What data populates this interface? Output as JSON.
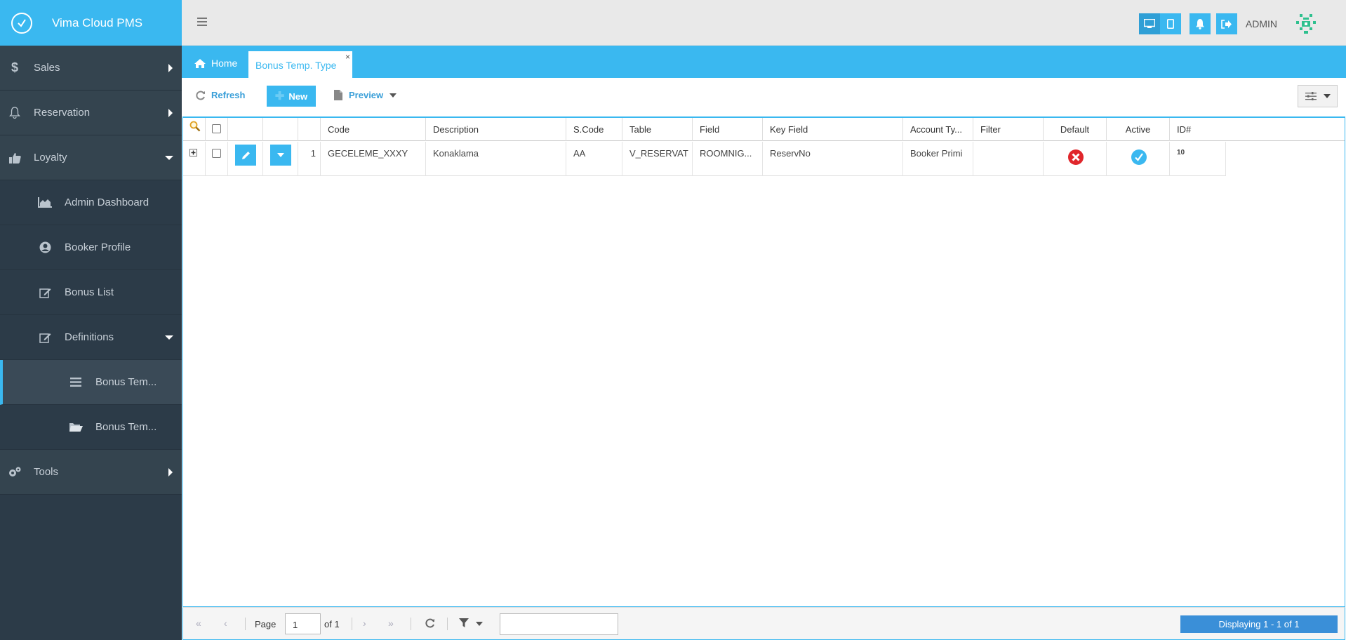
{
  "app": {
    "title": "Vima Cloud PMS"
  },
  "sidebar": {
    "items": [
      {
        "label": "Sales",
        "icon": "dollar-icon"
      },
      {
        "label": "Reservation",
        "icon": "bell-icon"
      },
      {
        "label": "Loyalty",
        "icon": "thumbs-up-icon"
      },
      {
        "label": "Admin Dashboard",
        "icon": "area-chart-icon"
      },
      {
        "label": "Booker Profile",
        "icon": "user-circle-icon"
      },
      {
        "label": "Bonus List",
        "icon": "edit-icon"
      },
      {
        "label": "Definitions",
        "icon": "edit-icon"
      },
      {
        "label": "Bonus Tem...",
        "icon": "list-icon"
      },
      {
        "label": "Bonus Tem...",
        "icon": "folder-open-icon"
      },
      {
        "label": "Tools",
        "icon": "cogs-icon"
      }
    ]
  },
  "header": {
    "user": "ADMIN"
  },
  "tabs": {
    "home": "Home",
    "active": "Bonus Temp. Type",
    "close": "×"
  },
  "toolbar": {
    "refresh": "Refresh",
    "new": "New",
    "preview": "Preview"
  },
  "grid": {
    "columns": [
      "Code",
      "Description",
      "S.Code",
      "Table",
      "Field",
      "Key Field",
      "Account Ty...",
      "Filter",
      "Default",
      "Active",
      "ID#"
    ],
    "rows": [
      {
        "num": "1",
        "code": "GECELEME_XXXY",
        "description": "Konaklama",
        "scode": "AA",
        "table": "V_RESERVAT",
        "field": "ROOMNIG...",
        "key_field": "ReservNo",
        "account_type": "Booker Primi",
        "filter": "",
        "default": false,
        "active": true,
        "id": "10"
      }
    ]
  },
  "pager": {
    "page_label": "Page",
    "page_value": "1",
    "of_label": "of 1",
    "display": "Displaying 1 - 1 of 1"
  },
  "colors": {
    "accent": "#3ab8f0",
    "sidebar_bg": "#2c3b48",
    "danger": "#e0262b"
  }
}
